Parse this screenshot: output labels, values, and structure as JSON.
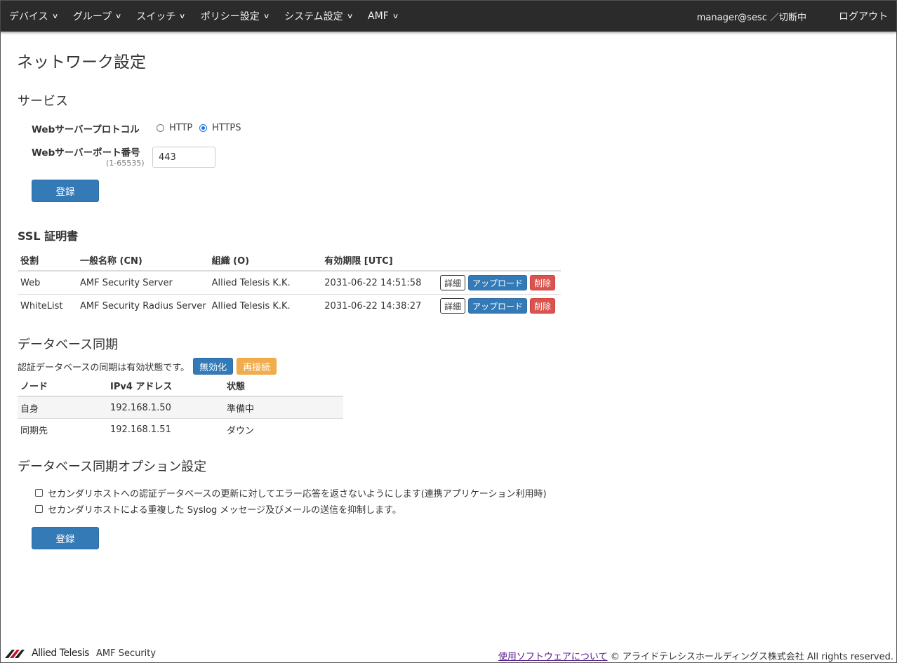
{
  "nav": {
    "items": [
      {
        "label": "デバイス"
      },
      {
        "label": "グループ"
      },
      {
        "label": "スイッチ"
      },
      {
        "label": "ポリシー設定"
      },
      {
        "label": "システム設定"
      },
      {
        "label": "AMF"
      }
    ],
    "user": "manager@sesc ／切断中",
    "logout": "ログアウト"
  },
  "page_title": "ネットワーク設定",
  "service": {
    "heading": "サービス",
    "protocol_label": "Webサーバープロトコル",
    "protocol_options": [
      "HTTP",
      "HTTPS"
    ],
    "protocol_selected": "HTTPS",
    "port_label": "Webサーバーポート番号",
    "port_range": "(1-65535)",
    "port_value": "443",
    "submit": "登録"
  },
  "ssl": {
    "heading": "SSL 証明書",
    "columns": [
      "役割",
      "一般名称 (CN)",
      "組織 (O)",
      "有効期限 [UTC]"
    ],
    "rows": [
      {
        "role": "Web",
        "cn": "AMF Security Server",
        "org": "Allied Telesis K.K.",
        "expires": "2031-06-22 14:51:58"
      },
      {
        "role": "WhiteList",
        "cn": "AMF Security Radius Server",
        "org": "Allied Telesis K.K.",
        "expires": "2031-06-22 14:38:27"
      }
    ],
    "actions": {
      "detail": "詳細",
      "upload": "アップロード",
      "delete": "削除"
    }
  },
  "db_sync": {
    "heading": "データベース同期",
    "status_text": "認証データベースの同期は有効状態です。",
    "disable_btn": "無効化",
    "reconnect_btn": "再接続",
    "columns": [
      "ノード",
      "IPv4 アドレス",
      "状態"
    ],
    "rows": [
      {
        "node": "自身",
        "ip": "192.168.1.50",
        "state": "準備中"
      },
      {
        "node": "同期先",
        "ip": "192.168.1.51",
        "state": "ダウン"
      }
    ]
  },
  "sync_options": {
    "heading": "データベース同期オプション設定",
    "options": [
      {
        "label": "セカンダリホストへの認証データベースの更新に対してエラー応答を返さないようにします(連携アプリケーション利用時)",
        "checked": false
      },
      {
        "label": "セカンダリホストによる重複した Syslog メッセージ及びメールの送信を抑制します。",
        "checked": false
      }
    ],
    "submit": "登録"
  },
  "footer": {
    "logo_text": "Allied Telesis",
    "app_name": "AMF Security",
    "software_link": "使用ソフトウェアについて",
    "copyright": "© アライドテレシスホールディングス株式会社 All rights reserved."
  }
}
